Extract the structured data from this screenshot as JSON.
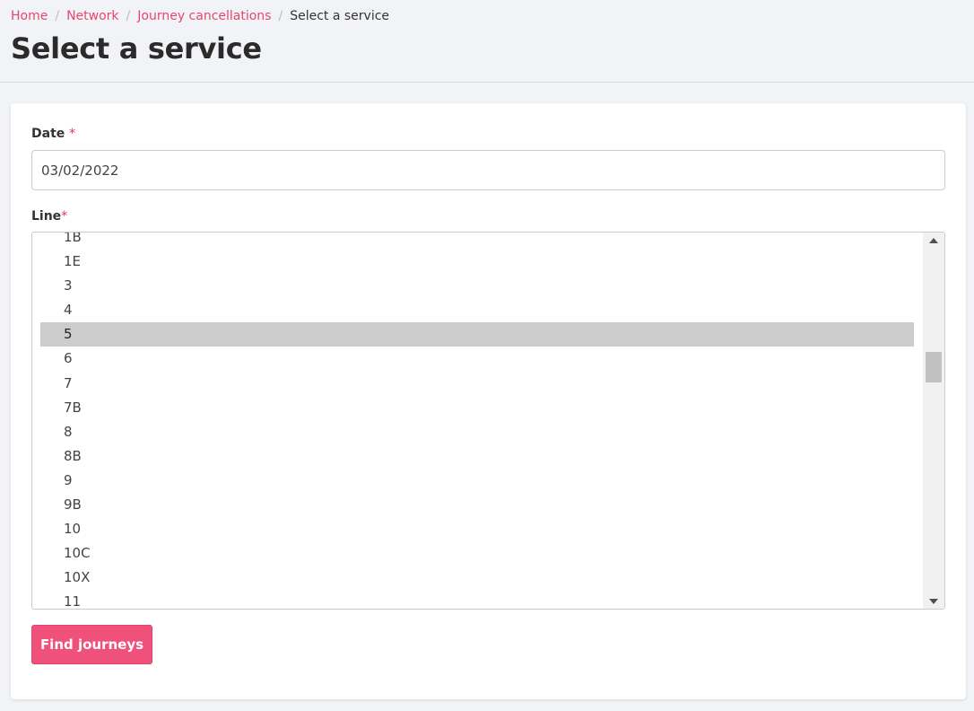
{
  "breadcrumb": {
    "items": [
      {
        "label": "Home"
      },
      {
        "label": "Network"
      },
      {
        "label": "Journey cancellations"
      }
    ],
    "current": "Select a service",
    "separator": "/"
  },
  "page": {
    "title": "Select a service"
  },
  "form": {
    "date": {
      "label": "Date",
      "required_marker": "*",
      "value": "03/02/2022"
    },
    "line": {
      "label": "Line",
      "required_marker": "*",
      "options": [
        "1B",
        "1E",
        "3",
        "4",
        "5",
        "6",
        "7",
        "7B",
        "8",
        "8B",
        "9",
        "9B",
        "10",
        "10C",
        "10X",
        "11"
      ],
      "selected": "5"
    },
    "submit_label": "Find journeys"
  },
  "colors": {
    "accent": "#f0517a",
    "link": "#e5476e",
    "selected_option_bg": "#cccccc"
  }
}
